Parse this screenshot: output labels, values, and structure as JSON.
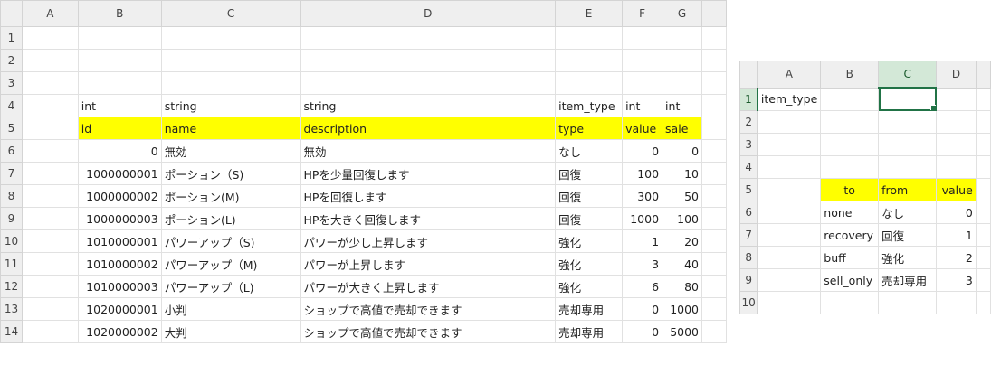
{
  "left_sheet": {
    "columns": [
      "A",
      "B",
      "C",
      "D",
      "E",
      "F",
      "G"
    ],
    "rows": [
      {
        "num": "1",
        "cells": [
          "",
          "",
          "",
          "",
          "",
          "",
          ""
        ]
      },
      {
        "num": "2",
        "cells": [
          "",
          "",
          "",
          "",
          "",
          "",
          ""
        ]
      },
      {
        "num": "3",
        "cells": [
          "",
          "",
          "",
          "",
          "",
          "",
          ""
        ]
      },
      {
        "num": "4",
        "cells": [
          "",
          "int",
          "string",
          "string",
          "item_type",
          "int",
          "int"
        ]
      },
      {
        "num": "5",
        "cells": [
          "",
          "id",
          "name",
          "description",
          "type",
          "value",
          "sale"
        ]
      },
      {
        "num": "6",
        "cells": [
          "",
          "0",
          "無効",
          "無効",
          "なし",
          "0",
          "0"
        ]
      },
      {
        "num": "7",
        "cells": [
          "",
          "1000000001",
          "ポーション（S)",
          "HPを少量回復します",
          "回復",
          "100",
          "10"
        ]
      },
      {
        "num": "8",
        "cells": [
          "",
          "1000000002",
          "ポーション(M)",
          "HPを回復します",
          "回復",
          "300",
          "50"
        ]
      },
      {
        "num": "9",
        "cells": [
          "",
          "1000000003",
          "ポーション(L)",
          "HPを大きく回復します",
          "回復",
          "1000",
          "100"
        ]
      },
      {
        "num": "10",
        "cells": [
          "",
          "1010000001",
          "パワーアップ（S)",
          "パワーが少し上昇します",
          "強化",
          "1",
          "20"
        ]
      },
      {
        "num": "11",
        "cells": [
          "",
          "1010000002",
          "パワーアップ（M)",
          "パワーが上昇します",
          "強化",
          "3",
          "40"
        ]
      },
      {
        "num": "12",
        "cells": [
          "",
          "1010000003",
          "パワーアップ（L)",
          "パワーが大きく上昇します",
          "強化",
          "6",
          "80"
        ]
      },
      {
        "num": "13",
        "cells": [
          "",
          "1020000001",
          "小判",
          "ショップで高値で売却できます",
          "売却専用",
          "0",
          "1000"
        ]
      },
      {
        "num": "14",
        "cells": [
          "",
          "1020000002",
          "大判",
          "ショップで高値で売却できます",
          "売却専用",
          "0",
          "5000"
        ]
      }
    ]
  },
  "right_sheet": {
    "columns": [
      "A",
      "B",
      "C",
      "D"
    ],
    "selected_column": "C",
    "selected_row": "1",
    "rows": [
      {
        "num": "1",
        "cells": [
          "item_type",
          "",
          "",
          ""
        ]
      },
      {
        "num": "2",
        "cells": [
          "",
          "",
          "",
          ""
        ]
      },
      {
        "num": "3",
        "cells": [
          "",
          "",
          "",
          ""
        ]
      },
      {
        "num": "4",
        "cells": [
          "",
          "",
          "",
          ""
        ]
      },
      {
        "num": "5",
        "cells": [
          "",
          "to",
          "from",
          "value"
        ]
      },
      {
        "num": "6",
        "cells": [
          "",
          "none",
          "なし",
          "0"
        ]
      },
      {
        "num": "7",
        "cells": [
          "",
          "recovery",
          "回復",
          "1"
        ]
      },
      {
        "num": "8",
        "cells": [
          "",
          "buff",
          "強化",
          "2"
        ]
      },
      {
        "num": "9",
        "cells": [
          "",
          "sell_only",
          "売却専用",
          "3"
        ]
      },
      {
        "num": "10",
        "cells": [
          "",
          "",
          "",
          ""
        ]
      }
    ]
  },
  "colors": {
    "highlight": "#ffff00",
    "selection": "#217346",
    "header_bg": "#efefef"
  }
}
